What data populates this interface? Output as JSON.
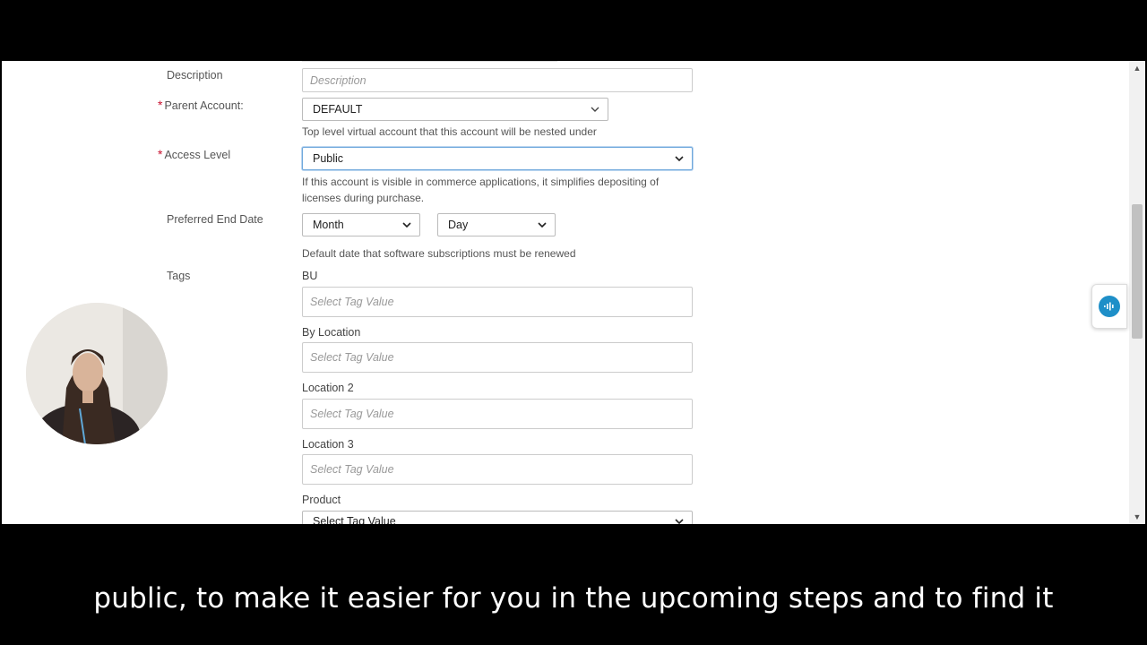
{
  "form": {
    "description_label": "Description",
    "description_placeholder": "Description",
    "parent_account_label": "Parent Account:",
    "parent_account_value": "DEFAULT",
    "parent_account_help": "Top level virtual account that this account will be nested under",
    "access_level_label": "Access Level",
    "access_level_value": "Public",
    "access_level_help_1": "If this account is visible in commerce applications, it simplifies depositing of",
    "access_level_help_2": "licenses during purchase.",
    "end_date_label": "Preferred End Date",
    "month_value": "Month",
    "day_value": "Day",
    "end_date_help": "Default date that software subscriptions must be renewed",
    "tags_label": "Tags",
    "required_mark": "*",
    "tags": [
      {
        "label": "BU",
        "placeholder": "Select Tag Value"
      },
      {
        "label": "By Location",
        "placeholder": "Select Tag Value"
      },
      {
        "label": "Location 2",
        "placeholder": "Select Tag Value"
      },
      {
        "label": "Location 3",
        "placeholder": "Select Tag Value"
      },
      {
        "label": "Product",
        "value": "Select Tag Value"
      }
    ]
  },
  "caption": "public, to make it easier for you in the upcoming steps and to find it",
  "colors": {
    "required": "#c8102e",
    "chat_accent": "#1e8fc8",
    "focus_border": "#6fa8dc"
  },
  "icons": {
    "chat": "chat-bubble-icon",
    "dropdown": "chevron-down-icon"
  }
}
